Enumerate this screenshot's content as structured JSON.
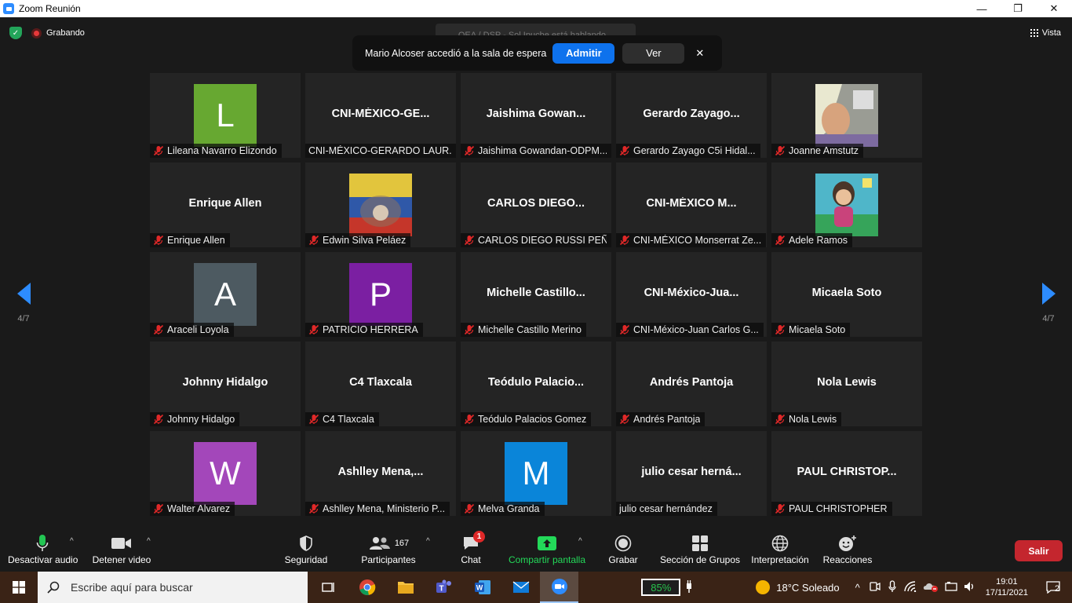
{
  "window": {
    "title": "Zoom Reunión",
    "minimize": "—",
    "maximize": "❐",
    "close": "✕"
  },
  "meeting": {
    "recording_label": "Grabando",
    "speaker_banner": "OEA / DSP - Sol Ipuche está hablando...",
    "view_label": "Vista",
    "waiting_room": {
      "message": "Mario Alcoser accedió a la sala de espera",
      "admit_label": "Admitir",
      "view_label": "Ver",
      "close": "✕"
    },
    "page_indicator_left": "4/7",
    "page_indicator_right": "4/7"
  },
  "colors": {
    "accent": "#2d8cff",
    "mute": "#e02828",
    "leave": "#c4262e",
    "share": "#23d959"
  },
  "participants": [
    {
      "name": "Lileana Navarro Elizondo",
      "avatar": "L",
      "avatar_color": "#67a831",
      "muted": true
    },
    {
      "name": "CNI-MÉXICO-GERARDO LAUR...",
      "display": "CNI-MÉXICO-GE...",
      "muted": false
    },
    {
      "name": "Jaishima Gowandan-ODPM...",
      "display": "Jaishima  Gowan...",
      "muted": true
    },
    {
      "name": "Gerardo Zayago C5i Hidal...",
      "display": "Gerardo  Zayago...",
      "muted": true
    },
    {
      "name": "Joanne Amstutz",
      "photo": "photo-joanne",
      "muted": true
    },
    {
      "name": "Enrique Allen",
      "display": "Enrique Allen",
      "muted": true
    },
    {
      "name": "Edwin Silva Peláez",
      "photo": "photo-edwin",
      "muted": true
    },
    {
      "name": "CARLOS DIEGO RUSSI PEÑA",
      "display": "CARLOS  DIEGO...",
      "muted": true
    },
    {
      "name": "CNI-MÉXICO Monserrat Ze...",
      "display": "CNI-MÉXICO  M...",
      "muted": true
    },
    {
      "name": "Adele Ramos",
      "photo": "photo-adele",
      "muted": true
    },
    {
      "name": "Araceli Loyola",
      "avatar": "A",
      "avatar_color": "#4d5a61",
      "muted": true
    },
    {
      "name": "PATRICIO HERRERA",
      "avatar": "P",
      "avatar_color": "#7b1fa2",
      "muted": true
    },
    {
      "name": "Michelle Castillo Merino",
      "display": "Michelle  Castillo...",
      "muted": true
    },
    {
      "name": "CNI-México-Juan Carlos G...",
      "display": "CNI-México-Jua...",
      "muted": true
    },
    {
      "name": "Micaela Soto",
      "display": "Micaela Soto",
      "muted": true
    },
    {
      "name": "Johnny Hidalgo",
      "display": "Johnny Hidalgo",
      "muted": true
    },
    {
      "name": "C4 Tlaxcala",
      "display": "C4 Tlaxcala",
      "muted": true
    },
    {
      "name": "Teódulo Palacios Gomez",
      "display": "Teódulo  Palacio...",
      "muted": true
    },
    {
      "name": "Andrés Pantoja",
      "display": "Andrés Pantoja",
      "muted": true
    },
    {
      "name": "Nola Lewis",
      "display": "Nola Lewis",
      "muted": true
    },
    {
      "name": "Walter Alvarez",
      "avatar": "W",
      "avatar_color": "#a347ba",
      "muted": true
    },
    {
      "name": "Ashlley Mena, Ministerio P...",
      "display": "Ashlley  Mena,...",
      "muted": true
    },
    {
      "name": "Melva Granda",
      "avatar": "M",
      "avatar_color": "#0a85d9",
      "muted": true
    },
    {
      "name": "julio cesar hernández",
      "display": "julio  cesar  herná...",
      "muted": false
    },
    {
      "name": "PAUL CHRISTOPHER",
      "display": "PAUL  CHRISTOP...",
      "muted": true
    }
  ],
  "toolbar": {
    "mute_label": "Desactivar audio",
    "video_label": "Detener video",
    "security_label": "Seguridad",
    "participants_label": "Participantes",
    "participants_count": "167",
    "chat_label": "Chat",
    "chat_badge": "1",
    "share_label": "Compartir pantalla",
    "record_label": "Grabar",
    "breakout_label": "Sección de Grupos",
    "interpretation_label": "Interpretación",
    "reactions_label": "Reacciones",
    "leave_label": "Salir"
  },
  "taskbar": {
    "search_placeholder": "Escribe aquí para buscar",
    "battery": "85%",
    "weather": "18°C  Soleado",
    "time": "19:01",
    "date": "17/11/2021",
    "notifications": "2",
    "apps": [
      "task-view-icon",
      "chrome-icon",
      "file-explorer-icon",
      "teams-icon",
      "word-icon",
      "mail-icon",
      "zoom-icon"
    ]
  }
}
